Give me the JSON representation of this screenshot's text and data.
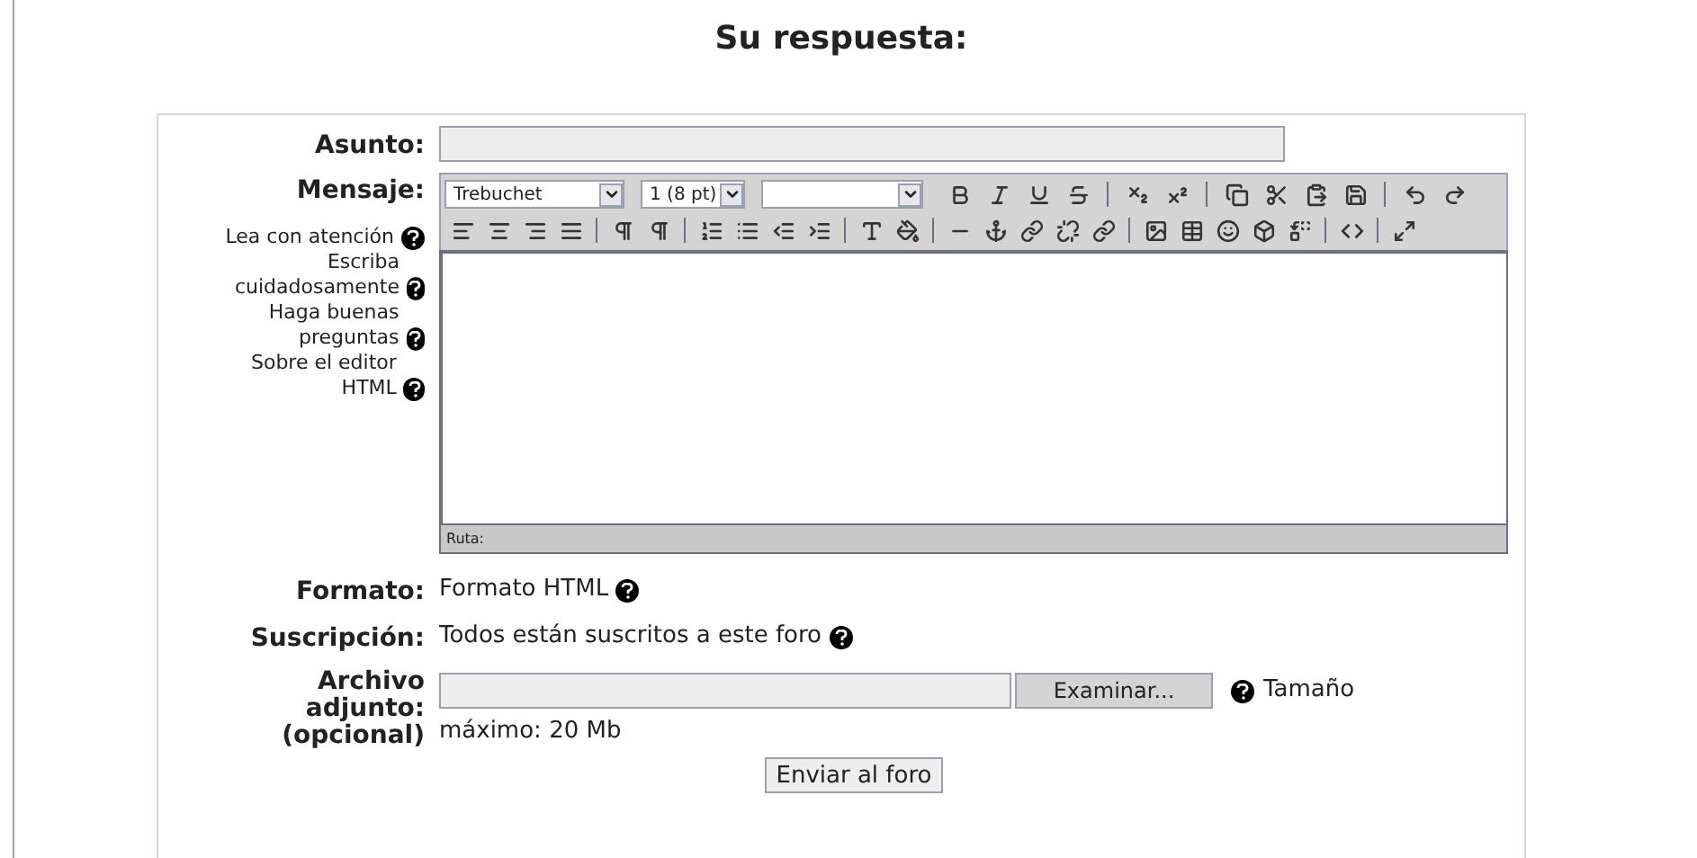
{
  "title": "Su respuesta:",
  "subject": {
    "label": "Asunto:"
  },
  "message": {
    "label": "Mensaje:",
    "help_links": [
      "Lea con atención",
      "Escriba cuidadosamente",
      "Haga buenas preguntas",
      "Sobre el editor HTML"
    ],
    "editor": {
      "font": "Trebuchet",
      "size": "1 (8 pt)",
      "path_label": "Ruta:"
    }
  },
  "format": {
    "label": "Formato:",
    "value": "Formato HTML"
  },
  "subscription": {
    "label": "Suscripción:",
    "value": "Todos están suscritos a este foro"
  },
  "attachment": {
    "label": "Archivo adjunto: (opcional)",
    "browse_button": "Examinar...",
    "note_start": "Tamaño",
    "note_end": "máximo: 20 Mb"
  },
  "submit_button": "Enviar al foro"
}
